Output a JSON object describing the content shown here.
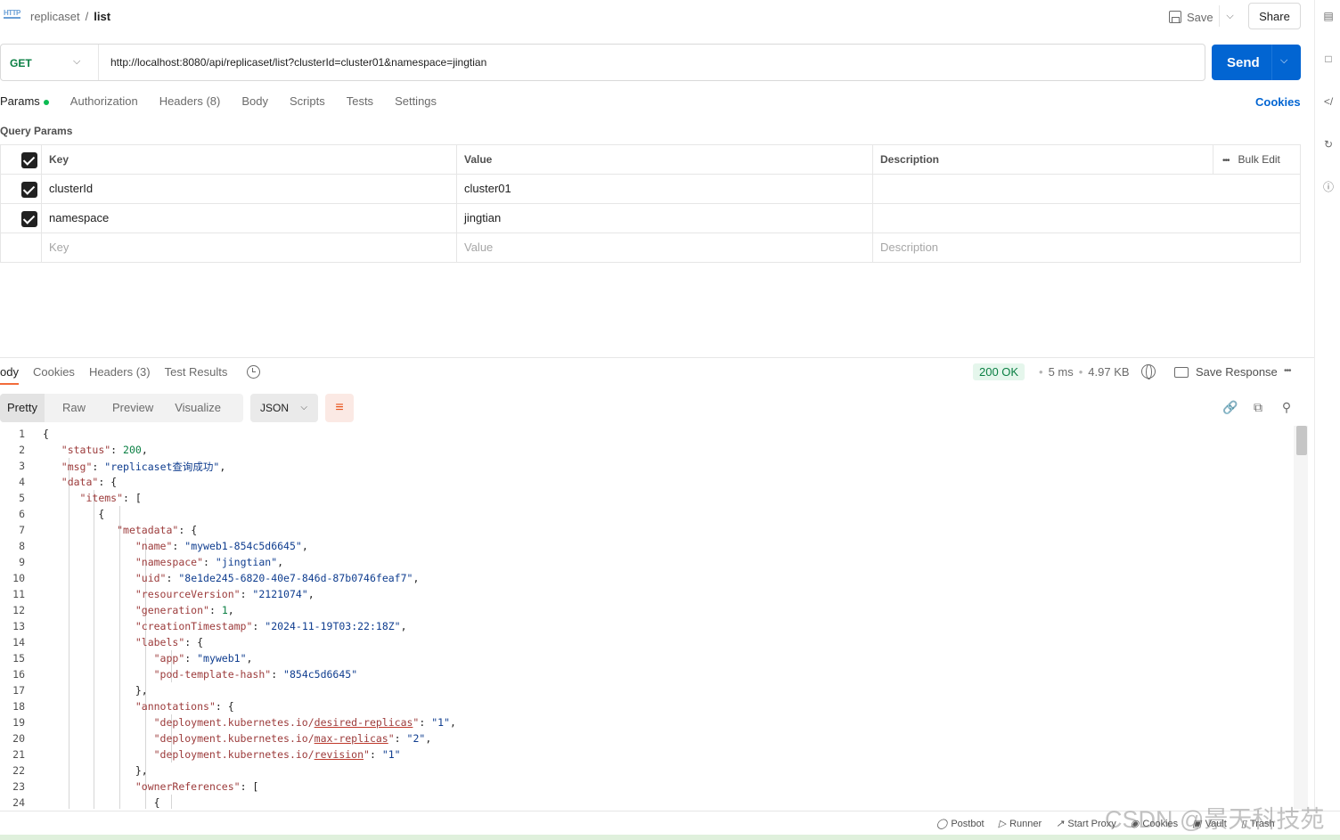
{
  "header": {
    "http_badge": "HTTP",
    "breadcrumb_parent": "replicaset",
    "breadcrumb_sep": "/",
    "breadcrumb_current": "list",
    "save_label": "Save",
    "share_label": "Share"
  },
  "request": {
    "method": "GET",
    "url": "http://localhost:8080/api/replicaset/list?clusterId=cluster01&namespace=jingtian",
    "send_label": "Send",
    "tabs": [
      {
        "label": "Params"
      },
      {
        "label": "Authorization"
      },
      {
        "label": "Headers",
        "count": "(8)"
      },
      {
        "label": "Body"
      },
      {
        "label": "Scripts"
      },
      {
        "label": "Tests"
      },
      {
        "label": "Settings"
      }
    ],
    "cookies_link": "Cookies"
  },
  "params": {
    "title": "Query Params",
    "columns": {
      "key": "Key",
      "value": "Value",
      "description": "Description"
    },
    "bulk_edit": "Bulk Edit",
    "more": "•••",
    "rows": [
      {
        "key": "clusterId",
        "value": "cluster01",
        "description": ""
      },
      {
        "key": "namespace",
        "value": "jingtian",
        "description": ""
      }
    ],
    "placeholder": {
      "key": "Key",
      "value": "Value",
      "description": "Description"
    }
  },
  "response": {
    "tabs": [
      {
        "label": "ody"
      },
      {
        "label": "Cookies"
      },
      {
        "label": "Headers",
        "count": "(3)"
      },
      {
        "label": "Test Results"
      }
    ],
    "status": "200 OK",
    "time": "5 ms",
    "size": "4.97 KB",
    "sep": "•",
    "save_response": "Save Response",
    "more": "•••",
    "view_tabs": [
      "Pretty",
      "Raw",
      "Preview",
      "Visualize"
    ],
    "format": "JSON",
    "line_numbers": [
      "1",
      "2",
      "3",
      "4",
      "5",
      "6",
      "7",
      "8",
      "9",
      "10",
      "11",
      "12",
      "13",
      "14",
      "15",
      "16",
      "17",
      "18",
      "19",
      "20",
      "21",
      "22",
      "23",
      "24"
    ]
  },
  "footer": {
    "items": [
      "Postbot",
      "Runner",
      "Start Proxy",
      "Cookies",
      "Vault",
      "Trash"
    ],
    "watermark": "CSDN @景天科技苑"
  },
  "colors": {
    "send": "#0265d2",
    "status_ok": "#0a7f43",
    "accent": "#f26b3a"
  }
}
